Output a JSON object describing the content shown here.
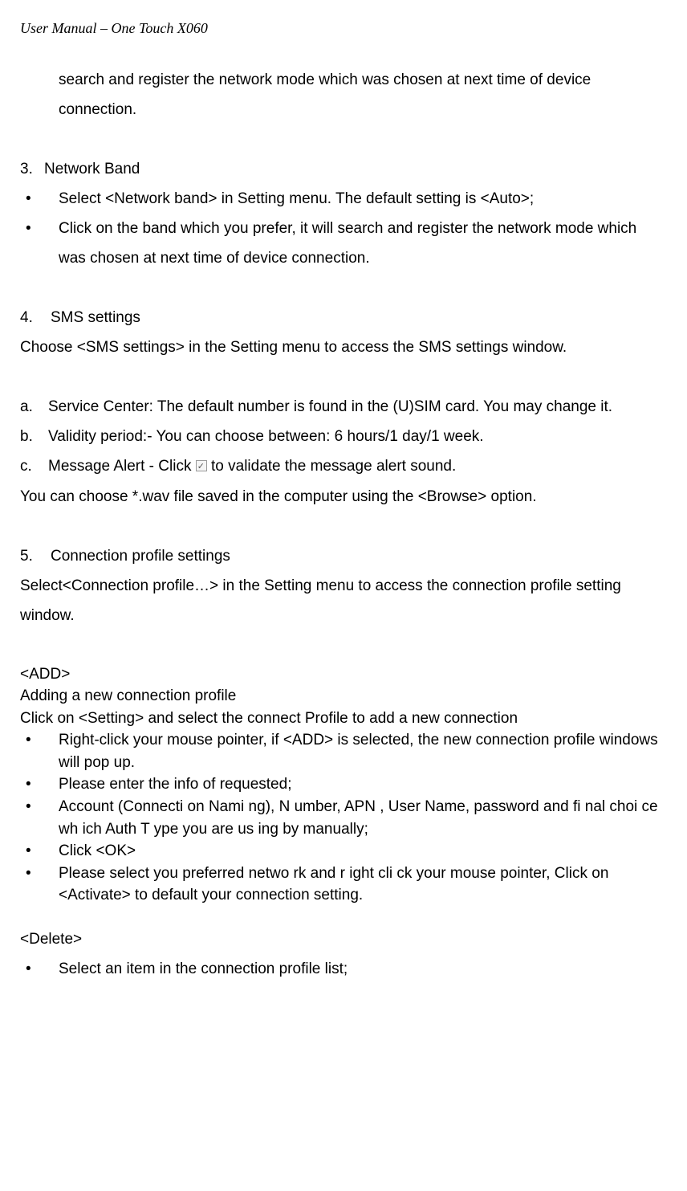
{
  "header": "User Manual – One Touch X060",
  "intro1": "search and register the network mode which was chosen at next time of device connection.",
  "section3": {
    "num": "3.",
    "title": "Network Band",
    "bullet1": "Select <Network band> in Setting menu. The default setting is <Auto>;",
    "bullet2": "Click on the band which you prefer, it will search and register the network mode which was chosen at next time of device connection."
  },
  "section4": {
    "num": "4.",
    "title": "SMS  settings",
    "para": "Choose <SMS settings> in the Setting menu to access the SMS settings window.",
    "a": "Service Center: The default number is found in the (U)SIM card. You may change it.",
    "b": "Validity period:- You can choose between: 6 hours/1 day/1 week.",
    "c_prefix": "Message Alert - Click ",
    "c_suffix": " to validate the message alert sound.",
    "after": "You can choose *.wav file saved in the computer using the <Browse> option."
  },
  "section5": {
    "num": "5.",
    "title": "Connection  profile settings",
    "para": "Select<Connection profile…> in the Setting menu to access the connection profile setting window."
  },
  "add": {
    "heading": "<ADD>",
    "sub1": "Adding a new connection profile",
    "sub2": "Click on <Setting> and select the connect Profile to add a new connection",
    "b1": " Right-click your mouse pointer, if <ADD> is selected, the new connection profile windows will pop up.",
    "b2": "Please enter the info of requested;",
    "b3": "Account (Connecti   on Nami   ng), N   umber, APN   , User Name, password and fi   nal choi ce wh ich Auth T   ype you are us    ing by manually;",
    "b4": "Click <OK>",
    "b5": "Please select you preferred netwo    rk and r  ight cli ck your mouse pointer, Click on <Activate> to default your connection setting."
  },
  "delete": {
    "heading": "<Delete>",
    "b1": "Select an item in the connection profile list;"
  },
  "markers": {
    "bullet": "•",
    "a": "a.",
    "b": "b.",
    "c": "c."
  }
}
